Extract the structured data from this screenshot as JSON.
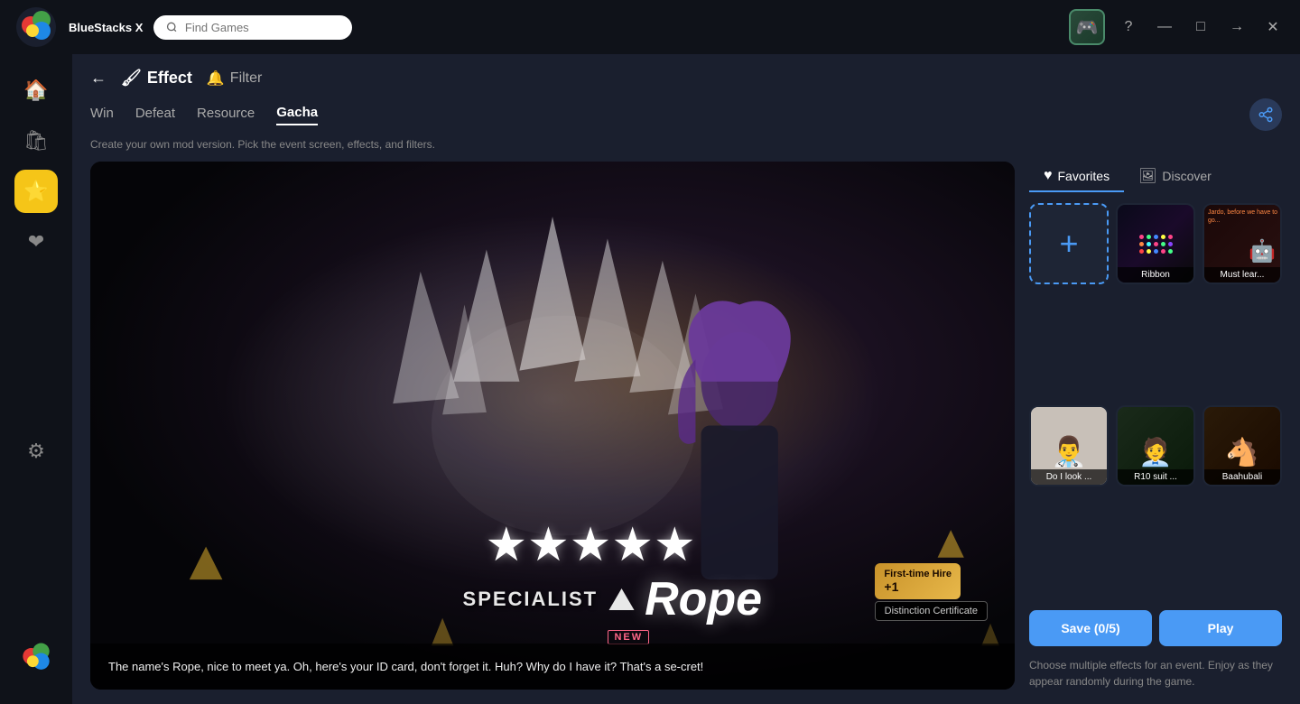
{
  "app": {
    "name": "BlueStacks X",
    "version": "X"
  },
  "titlebar": {
    "search_placeholder": "Find Games",
    "help_icon": "?",
    "minimize_icon": "—",
    "maximize_icon": "□",
    "arrow_icon": "→",
    "close_icon": "✕"
  },
  "sidebar": {
    "items": [
      {
        "id": "home",
        "icon": "🏠",
        "label": "Home"
      },
      {
        "id": "store",
        "icon": "🛒",
        "label": "Store"
      },
      {
        "id": "effects",
        "icon": "⭐",
        "label": "Effects",
        "active": true
      },
      {
        "id": "favorites",
        "icon": "❤",
        "label": "Favorites"
      },
      {
        "id": "settings",
        "icon": "⚙",
        "label": "Settings"
      }
    ]
  },
  "header": {
    "back_icon": "←",
    "effect_icon": "🖌",
    "effect_label": "Effect",
    "filter_icon": "🔔",
    "filter_label": "Filter"
  },
  "tabs": [
    {
      "id": "win",
      "label": "Win"
    },
    {
      "id": "defeat",
      "label": "Defeat",
      "active": false
    },
    {
      "id": "resource",
      "label": "Resource"
    },
    {
      "id": "gacha",
      "label": "Gacha",
      "active": true
    }
  ],
  "subtitle": "Create your own mod version. Pick the event screen, effects, and filters.",
  "share_icon": "share",
  "scene": {
    "character_name": "Rope",
    "character_title": "SPECIALIST",
    "stars": "★★★★★",
    "badge_new": "NEW",
    "hire_label": "First-time Hire",
    "hire_plus": "+1",
    "distinction_label": "Distinction Certificate",
    "dialogue": "The name's Rope, nice to meet ya. Oh, here's your ID card, don't forget it. Huh? Why do I have it? That's a se-cret!"
  },
  "right_panel": {
    "tabs": [
      {
        "id": "favorites",
        "icon": "♥",
        "label": "Favorites",
        "active": true
      },
      {
        "id": "discover",
        "icon": "🖼",
        "label": "Discover"
      }
    ],
    "effects": [
      {
        "id": "add",
        "type": "add",
        "label": "+"
      },
      {
        "id": "ribbon",
        "type": "ribbon",
        "label": "Ribbon"
      },
      {
        "id": "must-lear",
        "type": "must-lear",
        "label": "Must lear..."
      },
      {
        "id": "do-i-look",
        "type": "do-i-look",
        "label": "Do I look ..."
      },
      {
        "id": "r10-suit",
        "type": "r10-suit",
        "label": "R10 suit ..."
      },
      {
        "id": "baahubali",
        "type": "baahubali",
        "label": "Baahubali"
      }
    ],
    "save_label": "Save (0/5)",
    "play_label": "Play",
    "description": "Choose multiple effects for an event. Enjoy as they appear randomly during the game."
  }
}
